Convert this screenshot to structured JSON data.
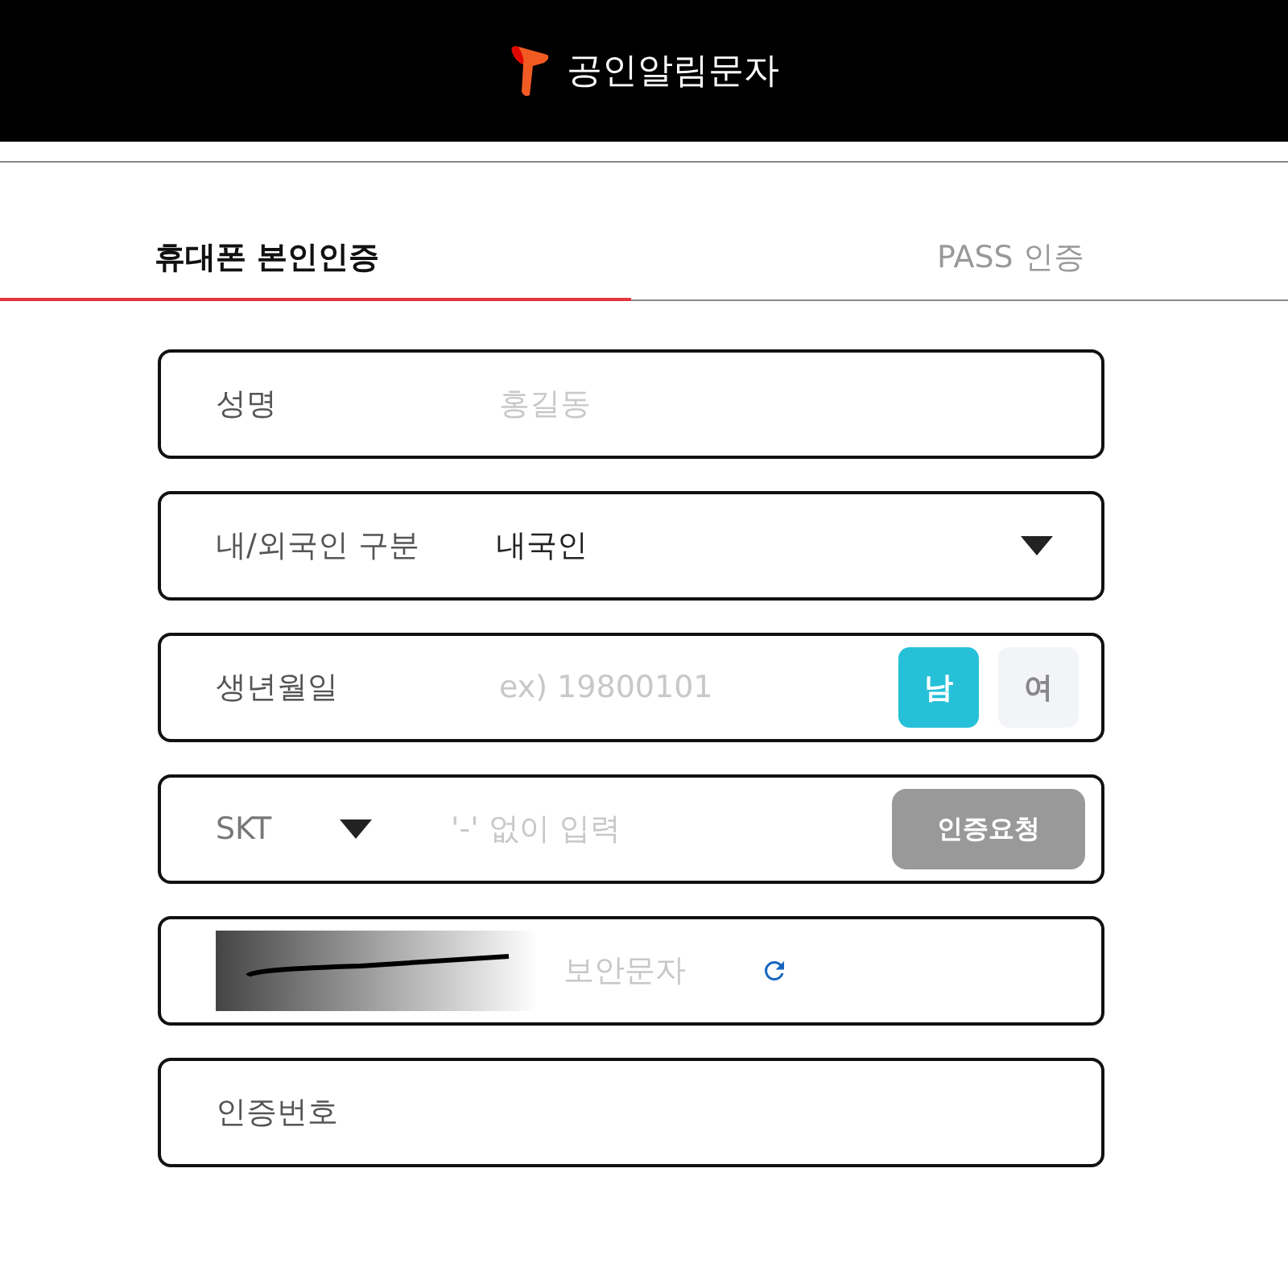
{
  "header": {
    "title": "공인알림문자"
  },
  "tabs": [
    {
      "label": "휴대폰 본인인증",
      "selected": true
    },
    {
      "label": "PASS 인증",
      "selected": false
    }
  ],
  "fields": [
    {
      "kind": "text",
      "label": "성명",
      "placeholder": "홍길동"
    },
    {
      "kind": "select",
      "label": "내/외국인 구분",
      "value": "내국인"
    },
    {
      "kind": "birth",
      "label": "생년월일",
      "placeholder": "ex) 19800101",
      "genders": [
        {
          "label": "남",
          "selected": true
        },
        {
          "label": "여",
          "selected": false
        }
      ]
    },
    {
      "kind": "phone",
      "carrier": "SKT",
      "placeholder": "'-' 없이 입력",
      "button": "인증요청"
    },
    {
      "kind": "captcha",
      "placeholder": "보안문자"
    },
    {
      "kind": "code",
      "label": "인증번호"
    }
  ]
}
